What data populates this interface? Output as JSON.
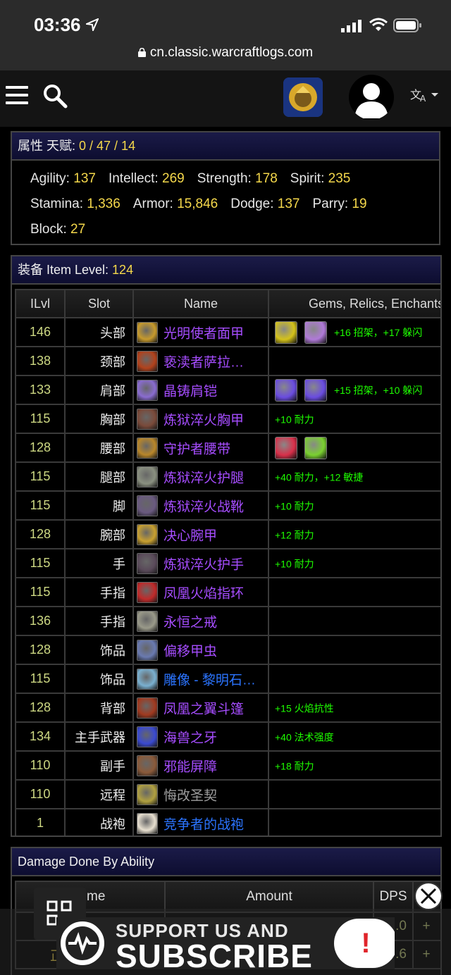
{
  "status": {
    "time": "03:36",
    "url": "cn.classic.warcraftlogs.com"
  },
  "stats": {
    "label": "属性 天赋: ",
    "talents": "0 / 47 / 14",
    "items": [
      {
        "label": "Agility: ",
        "value": "137"
      },
      {
        "label": "Intellect: ",
        "value": "269"
      },
      {
        "label": "Strength: ",
        "value": "178"
      },
      {
        "label": "Spirit: ",
        "value": "235"
      },
      {
        "label": "Stamina: ",
        "value": "1,336"
      },
      {
        "label": "Armor: ",
        "value": "15,846"
      },
      {
        "label": "Dodge: ",
        "value": "137"
      },
      {
        "label": "Parry: ",
        "value": "19"
      },
      {
        "label": "Block: ",
        "value": "27"
      }
    ]
  },
  "equipment": {
    "label": "装备 Item Level: ",
    "item_level": "124",
    "headers": [
      "ILvl",
      "Slot",
      "Name",
      "Gems, Relics, Enchants"
    ],
    "rows": [
      {
        "ilvl": "146",
        "slot": "头部",
        "name": "光明使者面甲",
        "quality": "epic",
        "icon": "#c79a2c",
        "gems": [
          "#d4c21a",
          "#b07ad8"
        ],
        "enchant": "+16 招架，+17 躲闪"
      },
      {
        "ilvl": "138",
        "slot": "颈部",
        "name": "亵渎者萨拉…",
        "quality": "epic",
        "icon": "#b2421c",
        "gems": [],
        "enchant": ""
      },
      {
        "ilvl": "133",
        "slot": "肩部",
        "name": "晶铸肩铠",
        "quality": "epic",
        "icon": "#8a6cd0",
        "gems": [
          "#6a4ce0",
          "#6a4ce0"
        ],
        "enchant": "+15 招架，+10 躲闪"
      },
      {
        "ilvl": "115",
        "slot": "胸部",
        "name": "炼狱淬火胸甲",
        "quality": "epic",
        "icon": "#7a4a3a",
        "gems": [],
        "enchant": "+10 耐力"
      },
      {
        "ilvl": "128",
        "slot": "腰部",
        "name": "守护者腰带",
        "quality": "epic",
        "icon": "#b8862a",
        "gems": [
          "#d8304a",
          "#7ad030"
        ],
        "enchant": ""
      },
      {
        "ilvl": "115",
        "slot": "腿部",
        "name": "炼狱淬火护腿",
        "quality": "epic",
        "icon": "#8a9080",
        "gems": [],
        "enchant": "+40 耐力，+12 敏捷"
      },
      {
        "ilvl": "115",
        "slot": "脚",
        "name": "炼狱淬火战靴",
        "quality": "epic",
        "icon": "#6a5a80",
        "gems": [],
        "enchant": "+10 耐力"
      },
      {
        "ilvl": "128",
        "slot": "腕部",
        "name": "决心腕甲",
        "quality": "epic",
        "icon": "#c8a030",
        "gems": [],
        "enchant": "+12 耐力"
      },
      {
        "ilvl": "115",
        "slot": "手",
        "name": "炼狱淬火护手",
        "quality": "epic",
        "icon": "#5a4a5a",
        "gems": [],
        "enchant": "+10 耐力"
      },
      {
        "ilvl": "115",
        "slot": "手指",
        "name": "凤凰火焰指环",
        "quality": "epic",
        "icon": "#c02a2a",
        "gems": [],
        "enchant": ""
      },
      {
        "ilvl": "136",
        "slot": "手指",
        "name": "永恒之戒",
        "quality": "epic",
        "icon": "#9a9a8a",
        "gems": [],
        "enchant": ""
      },
      {
        "ilvl": "128",
        "slot": "饰品",
        "name": "偏移甲虫",
        "quality": "epic",
        "icon": "#6a7ab0",
        "gems": [],
        "enchant": ""
      },
      {
        "ilvl": "115",
        "slot": "饰品",
        "name": "雕像 - 黎明石…",
        "quality": "rare",
        "icon": "#7ab0d0",
        "gems": [],
        "enchant": ""
      },
      {
        "ilvl": "128",
        "slot": "背部",
        "name": "凤凰之翼斗篷",
        "quality": "epic",
        "icon": "#a03a20",
        "gems": [],
        "enchant": "+15 火焰抗性"
      },
      {
        "ilvl": "134",
        "slot": "主手武器",
        "name": "海兽之牙",
        "quality": "epic",
        "icon": "#3a4ad0",
        "gems": [],
        "enchant": "+40 法术强度"
      },
      {
        "ilvl": "110",
        "slot": "副手",
        "name": "邪能屏障",
        "quality": "epic",
        "icon": "#8a5a3a",
        "gems": [],
        "enchant": "+18 耐力"
      },
      {
        "ilvl": "110",
        "slot": "远程",
        "name": "悔改圣契",
        "quality": "poor",
        "icon": "#b0a040",
        "gems": [],
        "enchant": ""
      },
      {
        "ilvl": "1",
        "slot": "战袍",
        "name": "竞争者的战袍",
        "quality": "rare",
        "icon": "#e8e0d0",
        "gems": [],
        "enchant": ""
      }
    ]
  },
  "damage": {
    "title": "Damage Done By Ability",
    "headers": [
      "Name",
      "Amount",
      "DPS"
    ],
    "name_header_visible": "me",
    "rows": [
      {
        "name": "",
        "amount": "",
        "dps": ".0",
        "plus": "+"
      },
      {
        "name": "正",
        "amount": "",
        "dps": ".6",
        "plus": "+"
      }
    ]
  },
  "ad": {
    "line1": "SUPPORT US AND",
    "line2": "SUBSCRIBE",
    "badge": "!"
  }
}
